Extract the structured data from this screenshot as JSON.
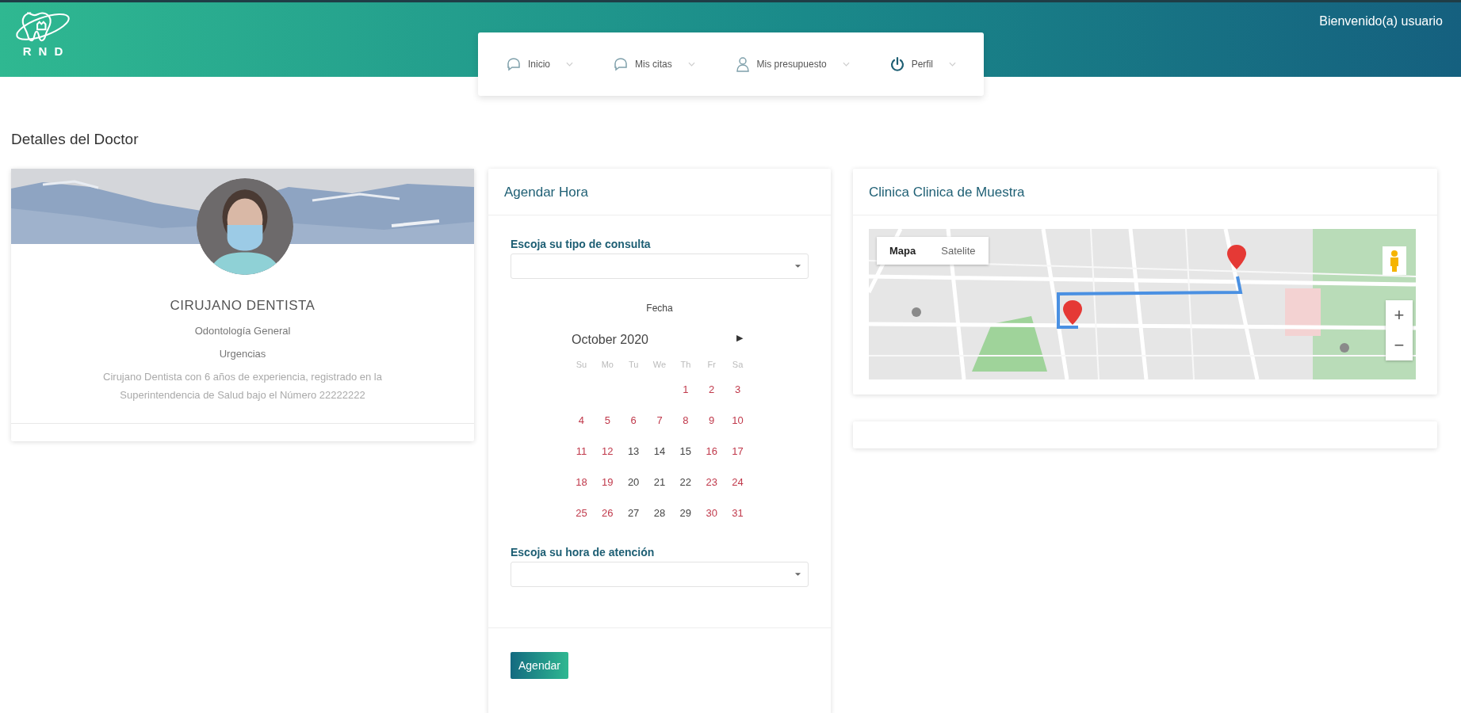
{
  "header": {
    "logo_text": "RND",
    "greeting": "Bienvenido(a) usuario"
  },
  "nav": [
    {
      "label": "Inicio",
      "kind": "bubble"
    },
    {
      "label": "Mis citas",
      "kind": "bubble"
    },
    {
      "label": "Mis presupuesto",
      "kind": "person"
    },
    {
      "label": "Perfil",
      "kind": "power"
    }
  ],
  "page_title": "Detalles del Doctor",
  "doctor": {
    "title": "CIRUJANO DENTISTA",
    "specialty": "Odontología General",
    "service": "Urgencias",
    "description": "Cirujano Dentista con 6 años de experiencia, registrado en la Superintendencia de Salud bajo el Número 22222222"
  },
  "booking": {
    "title": "Agendar Hora",
    "consult_label": "Escoja su tipo de consulta",
    "date_label": "Fecha",
    "calendar": {
      "month": "October 2020",
      "next": "▶",
      "weekdays": [
        "Su",
        "Mo",
        "Tu",
        "We",
        "Th",
        "Fr",
        "Sa"
      ],
      "weeks": [
        [
          {
            "day": "1",
            "available": false
          },
          {
            "day": "2",
            "available": false
          },
          {
            "day": "3",
            "available": false
          }
        ],
        [
          {
            "day": "4",
            "available": false
          },
          {
            "day": "5",
            "available": false
          },
          {
            "day": "6",
            "available": false
          },
          {
            "day": "7",
            "available": false
          },
          {
            "day": "8",
            "available": false
          },
          {
            "day": "9",
            "available": false
          },
          {
            "day": "10",
            "available": false
          }
        ],
        [
          {
            "day": "11",
            "available": false
          },
          {
            "day": "12",
            "available": false
          },
          {
            "day": "13",
            "available": true
          },
          {
            "day": "14",
            "available": true
          },
          {
            "day": "15",
            "available": true
          },
          {
            "day": "16",
            "available": false
          },
          {
            "day": "17",
            "available": false
          }
        ],
        [
          {
            "day": "18",
            "available": false
          },
          {
            "day": "19",
            "available": false
          },
          {
            "day": "20",
            "available": true
          },
          {
            "day": "21",
            "available": true
          },
          {
            "day": "22",
            "available": true
          },
          {
            "day": "23",
            "available": false
          },
          {
            "day": "24",
            "available": false
          }
        ],
        [
          {
            "day": "25",
            "available": false
          },
          {
            "day": "26",
            "available": false
          },
          {
            "day": "27",
            "available": true
          },
          {
            "day": "28",
            "available": true
          },
          {
            "day": "29",
            "available": true
          },
          {
            "day": "30",
            "available": false
          },
          {
            "day": "31",
            "available": false
          }
        ]
      ]
    },
    "hour_label": "Escoja su hora de atención",
    "submit": "Agendar"
  },
  "clinic": {
    "title": "Clinica Clinica de Muestra",
    "map": {
      "kind": "picture",
      "map_types": [
        {
          "label": "Mapa",
          "selected": true
        },
        {
          "label": "Satelite",
          "selected": false
        }
      ],
      "zoom_in": "+",
      "zoom_out": "−"
    }
  }
}
